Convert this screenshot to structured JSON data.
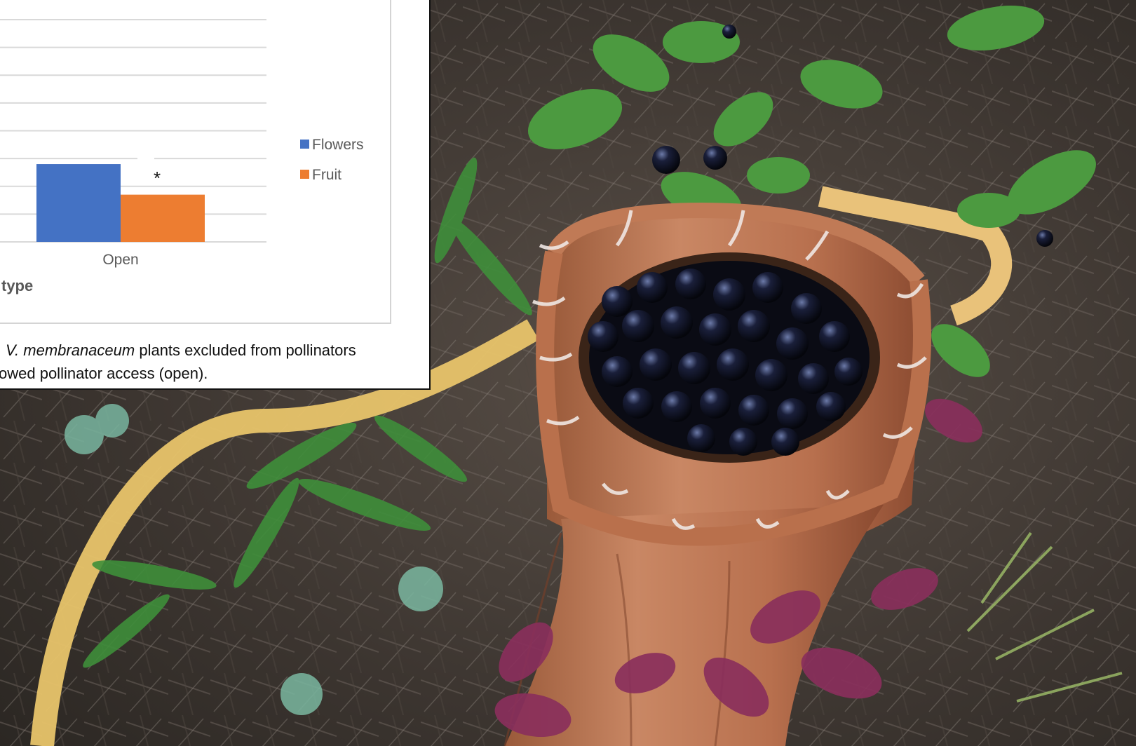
{
  "chart_data": {
    "type": "bar",
    "categories": [
      "Open"
    ],
    "series": [
      {
        "name": "Flowers",
        "values": [
          0.28
        ],
        "color": "#4472c4"
      },
      {
        "name": "Fruit",
        "values": [
          0.17
        ],
        "color": "#ed7d31"
      }
    ],
    "ylim": [
      0,
      0.8
    ],
    "grid": true,
    "legend_position": "right",
    "xlabel_fragment": "type",
    "annotation": "*"
  },
  "caption": {
    "species": "V. membranaceum",
    "line1_rest": " plants excluded from pollinators",
    "line2": "owed pollinator access (open)."
  },
  "photo": {
    "subject": "basket-of-huckleberries"
  },
  "colors": {
    "flowers": "#4472c4",
    "fruit": "#ed7d31",
    "grid": "#d9d9d9"
  }
}
